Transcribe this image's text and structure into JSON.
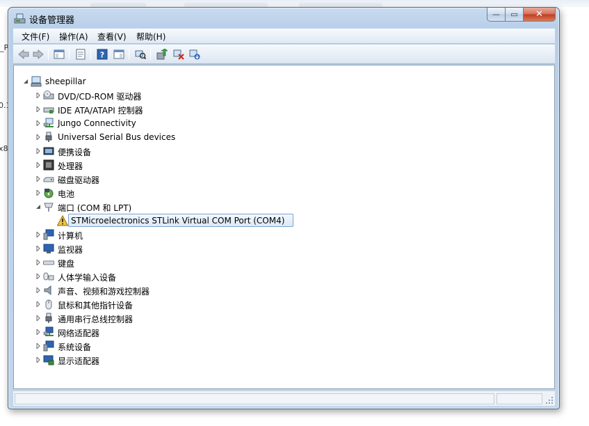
{
  "background": {
    "fragments": [
      "_P",
      "0.1",
      "x8"
    ]
  },
  "window": {
    "title": "设备管理器",
    "controls": {
      "minimize": "—",
      "maximize": "▭",
      "close": "✕"
    }
  },
  "menu": [
    {
      "label": "文件(F)"
    },
    {
      "label": "操作(A)"
    },
    {
      "label": "查看(V)"
    },
    {
      "label": "帮助(H)"
    }
  ],
  "toolbar": {
    "icons": [
      "back-icon",
      "forward-icon",
      "show-hide-console-tree-icon",
      "properties-icon",
      "help-icon",
      "show-action-pane-icon",
      "scan-hardware-icon",
      "update-driver-icon",
      "disable-device-icon",
      "uninstall-device-icon"
    ]
  },
  "tree": {
    "root": {
      "label": "sheepillar"
    },
    "categories": [
      {
        "label": "DVD/CD-ROM 驱动器",
        "icon": "dvd-drive-icon"
      },
      {
        "label": "IDE ATA/ATAPI 控制器",
        "icon": "ide-controller-icon"
      },
      {
        "label": "Jungo Connectivity",
        "icon": "network-device-icon"
      },
      {
        "label": "Universal Serial Bus devices",
        "icon": "usb-plug-icon"
      },
      {
        "label": "便携设备",
        "icon": "portable-device-icon"
      },
      {
        "label": "处理器",
        "icon": "processor-icon"
      },
      {
        "label": "磁盘驱动器",
        "icon": "disk-drive-icon"
      },
      {
        "label": "电池",
        "icon": "battery-icon"
      },
      {
        "label": "端口 (COM 和 LPT)",
        "icon": "port-icon",
        "expanded": true,
        "children": [
          {
            "label": "STMicroelectronics STLink Virtual COM Port (COM4)",
            "icon": "warning-icon"
          }
        ]
      },
      {
        "label": "计算机",
        "icon": "computer-icon"
      },
      {
        "label": "监视器",
        "icon": "monitor-icon"
      },
      {
        "label": "键盘",
        "icon": "keyboard-icon"
      },
      {
        "label": "人体学输入设备",
        "icon": "hid-icon"
      },
      {
        "label": "声音、视频和游戏控制器",
        "icon": "speaker-icon"
      },
      {
        "label": "鼠标和其他指针设备",
        "icon": "mouse-icon"
      },
      {
        "label": "通用串行总线控制器",
        "icon": "usb-plug-icon"
      },
      {
        "label": "网络适配器",
        "icon": "network-adapter-icon"
      },
      {
        "label": "系统设备",
        "icon": "system-device-icon"
      },
      {
        "label": "显示适配器",
        "icon": "display-adapter-icon"
      }
    ]
  },
  "colors": {
    "selection_border": "#7da2ce",
    "warning": "#f2c53d"
  }
}
